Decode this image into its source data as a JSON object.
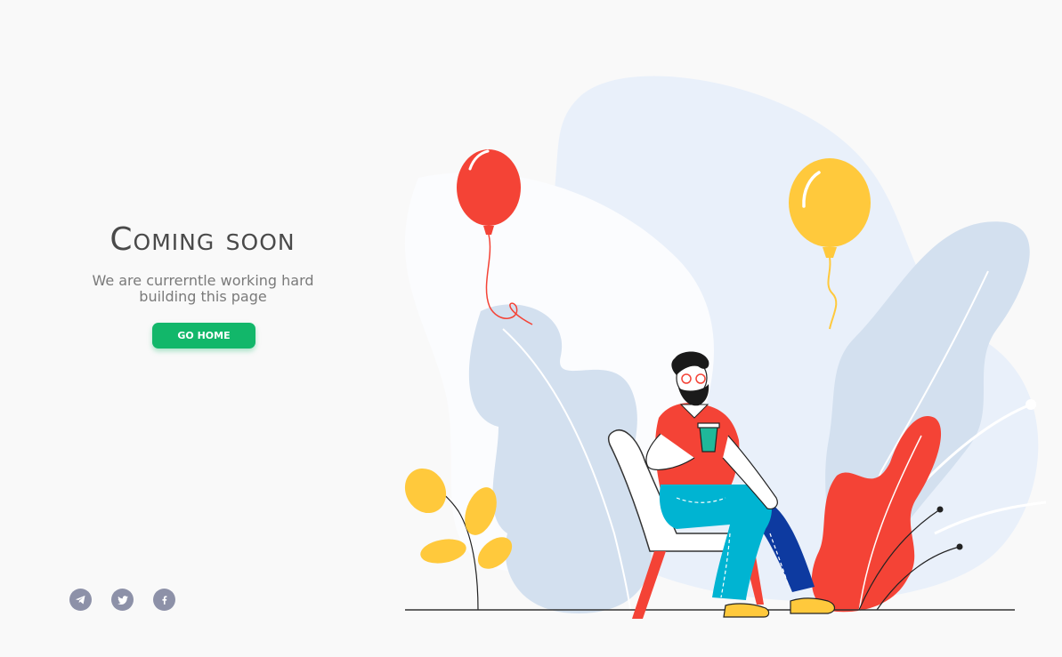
{
  "page": {
    "title": "Coming soon",
    "subtitle_line1": "We are currerntle working hard",
    "subtitle_line2": "building this page",
    "button_label": "GO HOME"
  },
  "socials": [
    {
      "icon": "telegram-icon"
    },
    {
      "icon": "twitter-icon"
    },
    {
      "icon": "facebook-icon"
    }
  ],
  "colors": {
    "background": "#f9f9f9",
    "accent": "#12b76a",
    "social": "#8d91a8",
    "balloon_red": "#f44336",
    "balloon_yellow": "#ffc93c"
  }
}
